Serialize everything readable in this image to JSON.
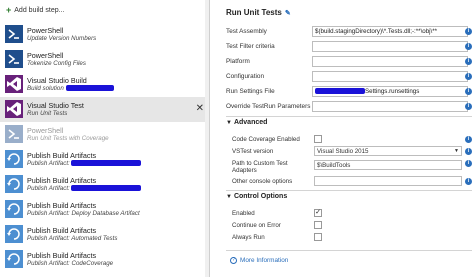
{
  "left": {
    "add_step_label": "Add build step...",
    "tasks": [
      {
        "name": "PowerShell",
        "sub": "Update Version Numbers",
        "icon": "powershell-icon",
        "state": "normal"
      },
      {
        "name": "PowerShell",
        "sub": "Tokenize Config Files",
        "icon": "powershell-icon",
        "state": "normal"
      },
      {
        "name": "Visual Studio Build",
        "sub": "Build solution",
        "icon": "visual-studio-icon",
        "state": "normal",
        "redacted": true
      },
      {
        "name": "Visual Studio Test",
        "sub": "Run Unit Tests",
        "icon": "visual-studio-icon",
        "state": "selected"
      },
      {
        "name": "PowerShell",
        "sub": "Run Unit Tests with Coverage",
        "icon": "powershell-icon",
        "state": "disabled"
      },
      {
        "name": "Publish Build Artifacts",
        "sub": "Publish Artifact:",
        "icon": "publish-icon",
        "state": "normal",
        "redacted": true
      },
      {
        "name": "Publish Build Artifacts",
        "sub": "Publish Artifact:",
        "icon": "publish-icon",
        "state": "normal",
        "redacted": true
      },
      {
        "name": "Publish Build Artifacts",
        "sub": "Publish Artifact: Deploy Database Artifact",
        "icon": "publish-icon",
        "state": "normal"
      },
      {
        "name": "Publish Build Artifacts",
        "sub": "Publish Artifact: Automated Tests",
        "icon": "publish-icon",
        "state": "normal"
      },
      {
        "name": "Publish Build Artifacts",
        "sub": "Publish Artifact: CodeCoverage",
        "icon": "publish-icon",
        "state": "normal"
      }
    ],
    "close_glyph": "✕"
  },
  "right": {
    "title": "Run Unit Tests",
    "fields": [
      {
        "label": "Test Assembly",
        "value": "$(build.stagingDirectory)\\*.Tests.dll;-:**\\obj\\**"
      },
      {
        "label": "Test Filter criteria",
        "value": ""
      },
      {
        "label": "Platform",
        "value": ""
      },
      {
        "label": "Configuration",
        "value": ""
      },
      {
        "label": "Run Settings File",
        "value": "Settings.runsettings",
        "redacted": true
      },
      {
        "label": "Override TestRun Parameters",
        "value": ""
      }
    ],
    "advanced": {
      "title": "Advanced",
      "code_coverage_label": "Code Coverage Enabled",
      "code_coverage_checked": false,
      "vstest_label": "VSTest version",
      "vstest_value": "Visual Studio 2015",
      "custom_path_label": "Path to Custom Test Adapters",
      "custom_path_value": "$\\BuildTools",
      "console_label": "Other console options",
      "console_value": ""
    },
    "control": {
      "title": "Control Options",
      "enabled_label": "Enabled",
      "enabled_checked": true,
      "continue_label": "Continue on Error",
      "continue_checked": false,
      "always_label": "Always Run",
      "always_checked": false
    },
    "more_info": "More Information"
  },
  "colors": {
    "link": "#2a6ebb",
    "redaction": "#1a12d8",
    "selected_bg": "#e6e6e6"
  }
}
